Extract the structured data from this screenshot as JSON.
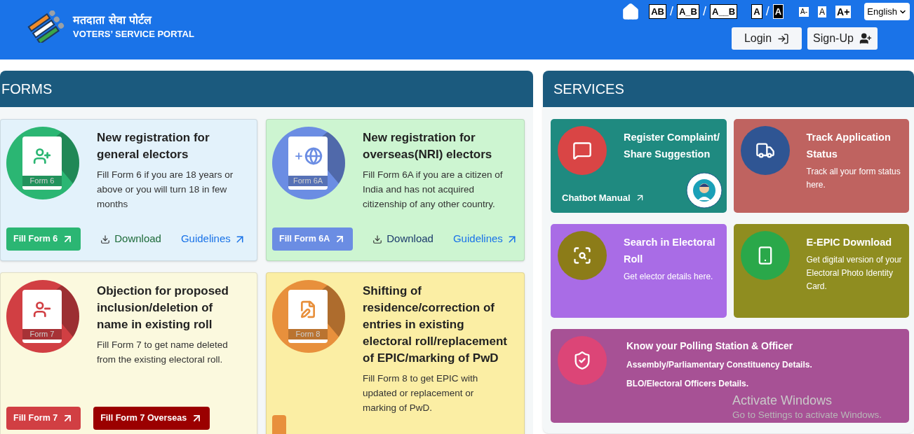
{
  "header": {
    "title_hindi": "मतदाता सेवा पोर्टल",
    "title": "VOTERS’ SERVICE PORTAL",
    "separator": "/",
    "spacing_options": [
      "AB",
      "A_B",
      "A__B"
    ],
    "contrast_options": [
      {
        "label": "A",
        "kind": "normal"
      },
      {
        "label": "A",
        "kind": "dark"
      }
    ],
    "font_sizes": [
      "A-",
      "A",
      "A+"
    ],
    "language": "English",
    "buttons": [
      {
        "label": "Login",
        "kind": "login"
      },
      {
        "label": "Sign-Up",
        "kind": "signup"
      }
    ]
  },
  "forms": {
    "title": "FORMS",
    "cards": [
      {
        "form": "Form 6",
        "color": "#2bb673",
        "title": "New registration for general electors",
        "description": "Fill Form 6 if you are 18 years or above or you will turn 18 in few months",
        "actions": [
          {
            "kind": "primary",
            "label": "Fill Form 6",
            "color": "#2bb673"
          },
          {
            "kind": "download",
            "label": "Download",
            "color": "#1e6b3a"
          },
          {
            "kind": "link",
            "label": "Guidelines",
            "color": "#1a73e8"
          }
        ]
      },
      {
        "form": "Form 6A",
        "color": "#6b8de3",
        "title": "New registration for overseas(NRI) electors",
        "description": "Fill Form 6A if you are a citizen of India and has not acquired citizenship of any other country.",
        "actions": [
          {
            "kind": "primary",
            "label": "Fill Form 6A",
            "color": "#6b8de3"
          },
          {
            "kind": "download",
            "label": "Download",
            "color": "#1b3a6b"
          },
          {
            "kind": "link",
            "label": "Guidelines",
            "color": "#1a73e8"
          }
        ]
      },
      {
        "form": "Form 7",
        "color": "#d13f43",
        "title": "Objection for proposed inclusion/deletion of name in existing roll",
        "description": "Fill Form 7 to get name deleted from the existing electoral roll.",
        "actions": [
          {
            "kind": "primary",
            "label": "Fill Form 7",
            "color": "#d13f43"
          },
          {
            "kind": "primary",
            "label": "Fill Form 7 Overseas",
            "color": "#9b0000"
          }
        ]
      },
      {
        "form": "Form 8",
        "color": "#e8903c",
        "title": "Shifting of residence/correction of entries in existing electoral roll/replacement of EPIC/marking of PwD",
        "description": "Fill Form 8 to get EPIC with updated or replacement or marking of PwD.",
        "actions": [
          {
            "kind": "primary",
            "color": "#e8903c"
          }
        ]
      }
    ]
  },
  "services": {
    "title": "SERVICES",
    "cards": [
      {
        "color": "#d94545",
        "title": "Register Complaint/ Share Suggestion",
        "link": "Chatbot Manual"
      },
      {
        "color": "#2f5593",
        "title": "Track Application Status",
        "lines": [
          "Track all your form status here."
        ]
      },
      {
        "color": "#8c7c18",
        "title": "Search in Electoral Roll",
        "lines": [
          "Get elector details here."
        ]
      },
      {
        "color": "#2aa84a",
        "title": "E-EPIC Download",
        "lines": [
          "Get digital version of your Electoral Photo Identity Card."
        ]
      },
      {
        "color": "#dc4577",
        "title": "Know your Polling Station & Officer",
        "lines": [
          "Assembly/Parliamentary Constituency Details.",
          "BLO/Electoral Officers Details."
        ]
      }
    ]
  },
  "os_notice": {
    "title": "Activate Windows",
    "subtitle": "Go to Settings to activate Windows."
  }
}
